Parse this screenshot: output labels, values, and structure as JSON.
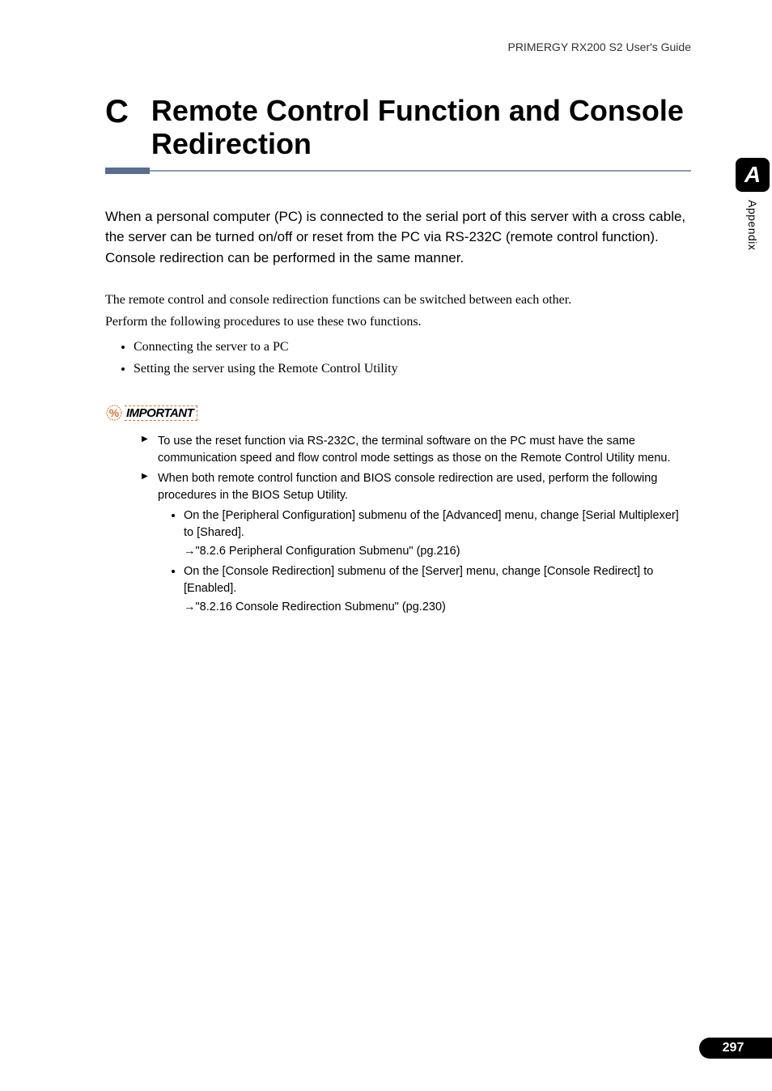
{
  "header": "PRIMERGY RX200 S2 User's Guide",
  "chapter": {
    "letter": "C",
    "title": "Remote Control Function and Console Redirection"
  },
  "intro": "When a personal computer (PC) is connected to the serial port of this server with a cross cable, the server can be turned on/off or reset from the PC via RS-232C (remote control function). Console redirection can be performed in the same manner.",
  "body": {
    "line1": "The remote control and console redirection functions can be switched between each other.",
    "line2": "Perform the following procedures to use these two functions."
  },
  "procedures": [
    "Connecting the server to a PC",
    "Setting the server using the Remote Control Utility"
  ],
  "important_label": "IMPORTANT",
  "important": {
    "item1": "To use the reset function via RS-232C, the terminal software on the PC must have the same communication speed and flow control mode settings as those on the Remote Control Utility menu.",
    "item2": "When both remote control function and BIOS console redirection are used, perform the following procedures in the BIOS Setup Utility.",
    "sub1": "On the [Peripheral Configuration] submenu of the [Advanced] menu, change [Serial Multiplexer] to [Shared].",
    "ref1": "→\"8.2.6 Peripheral Configuration Submenu\" (pg.216)",
    "sub2": "On the [Console Redirection] submenu of the [Server] menu, change [Console Redirect] to [Enabled].",
    "ref2": "→\"8.2.16 Console Redirection Submenu\" (pg.230)"
  },
  "side_tab": {
    "letter": "A",
    "label": "Appendix"
  },
  "page_number": "297"
}
